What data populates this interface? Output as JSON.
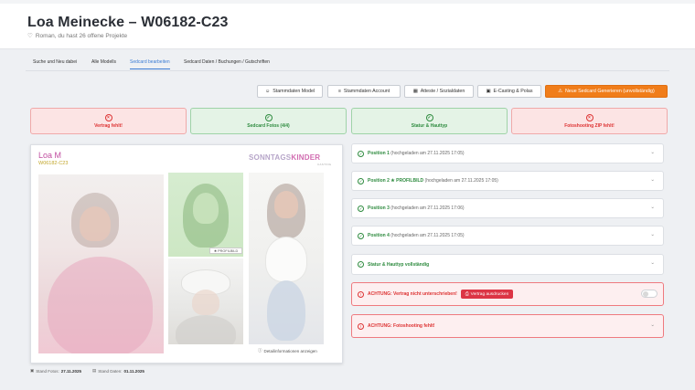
{
  "header": {
    "title": "Loa Meinecke – W06182-C23",
    "subtitle": "Roman, du hast 26 offene Projekte"
  },
  "tabs": [
    {
      "label": "Suche und Neu dabei",
      "active": false
    },
    {
      "label": "Alle Modells",
      "active": false
    },
    {
      "label": "Sedcard bearbeiten",
      "active": true
    },
    {
      "label": "Sedcard Daten / Buchungen / Gutschriften",
      "active": false
    }
  ],
  "toolbar": {
    "stammdaten_model": "Stammdaten Model",
    "stammdaten_account": "Stammdaten Account",
    "atteste": "Atteste / Sozialdaten",
    "ecasting": "E-Casting & Polas",
    "generate": "Neue Sedcard Generieren (unvollständig)"
  },
  "status_cards": [
    {
      "label": "Vertrag fehlt!",
      "state": "error",
      "icon": "x-circle-icon"
    },
    {
      "label": "Sedcard Fotos (4/4)",
      "state": "ok",
      "icon": "check-circle-icon"
    },
    {
      "label": "Statur & Hauttyp",
      "state": "ok",
      "icon": "check-circle-icon"
    },
    {
      "label": "Fotoshooting ZIP fehlt!",
      "state": "error",
      "icon": "x-circle-icon"
    }
  ],
  "sedcard": {
    "name": "Loa M",
    "code": "W06182-C23",
    "logo_part1": "SONNTAGS",
    "logo_part2": "KINDER",
    "logo_sub": "CASTING",
    "profilbild_label": "PROFILBILD",
    "details_link": "Detailinformationen anzeigen"
  },
  "footer": {
    "stand_fotos_label": "Stand Fotos:",
    "stand_fotos_value": "27.11.2025",
    "stand_daten_label": "Stand Daten:",
    "stand_daten_value": "01.11.2025"
  },
  "accordion": [
    {
      "title": "Position 1",
      "detail": "(hochgeladen am 27.11.2025 17:05)",
      "state": "ok"
    },
    {
      "title": "Position 2 ★ PROFILBILD",
      "detail": "(hochgeladen am 27.11.2025 17:05)",
      "state": "ok"
    },
    {
      "title": "Position 3",
      "detail": "(hochgeladen am 27.11.2025 17:06)",
      "state": "ok"
    },
    {
      "title": "Position 4",
      "detail": "(hochgeladen am 27.11.2025 17:05)",
      "state": "ok"
    },
    {
      "title": "Statur & Hauttyp vollständig",
      "detail": "",
      "state": "ok"
    }
  ],
  "alerts": {
    "vertrag": "ACHTUNG: Vertrag nicht unterschrieben!",
    "vertrag_button": "Vertrag ausdrucken",
    "fotoshooting": "ACHTUNG: Fotoshooting fehlt!"
  },
  "colors": {
    "accent_blue": "#3b7bd4",
    "orange": "#f07d1a",
    "success": "#2e8b3f",
    "danger": "#d33"
  }
}
